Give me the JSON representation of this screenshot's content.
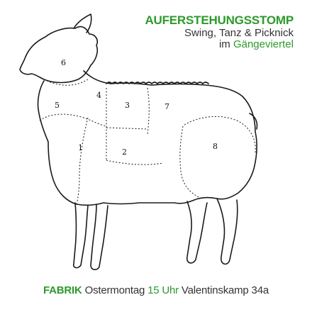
{
  "header": {
    "title": "AUFERSTEHUNGSSTOMP",
    "line2": "Swing, Tanz & Picknick",
    "line3_prefix": "im",
    "line3_place": "Gängeviertel"
  },
  "illustration": {
    "name": "sheep-cuts-drawing",
    "cut_labels": [
      "1",
      "2",
      "3",
      "4",
      "5",
      "6",
      "7",
      "8"
    ]
  },
  "footer": {
    "venue": "FABRIK",
    "day": "Ostermontag",
    "time": "15 Uhr",
    "address": "Valentinskamp 34a"
  },
  "colors": {
    "accent": "#2c9a2a",
    "text": "#333333",
    "background": "#ffffff"
  }
}
